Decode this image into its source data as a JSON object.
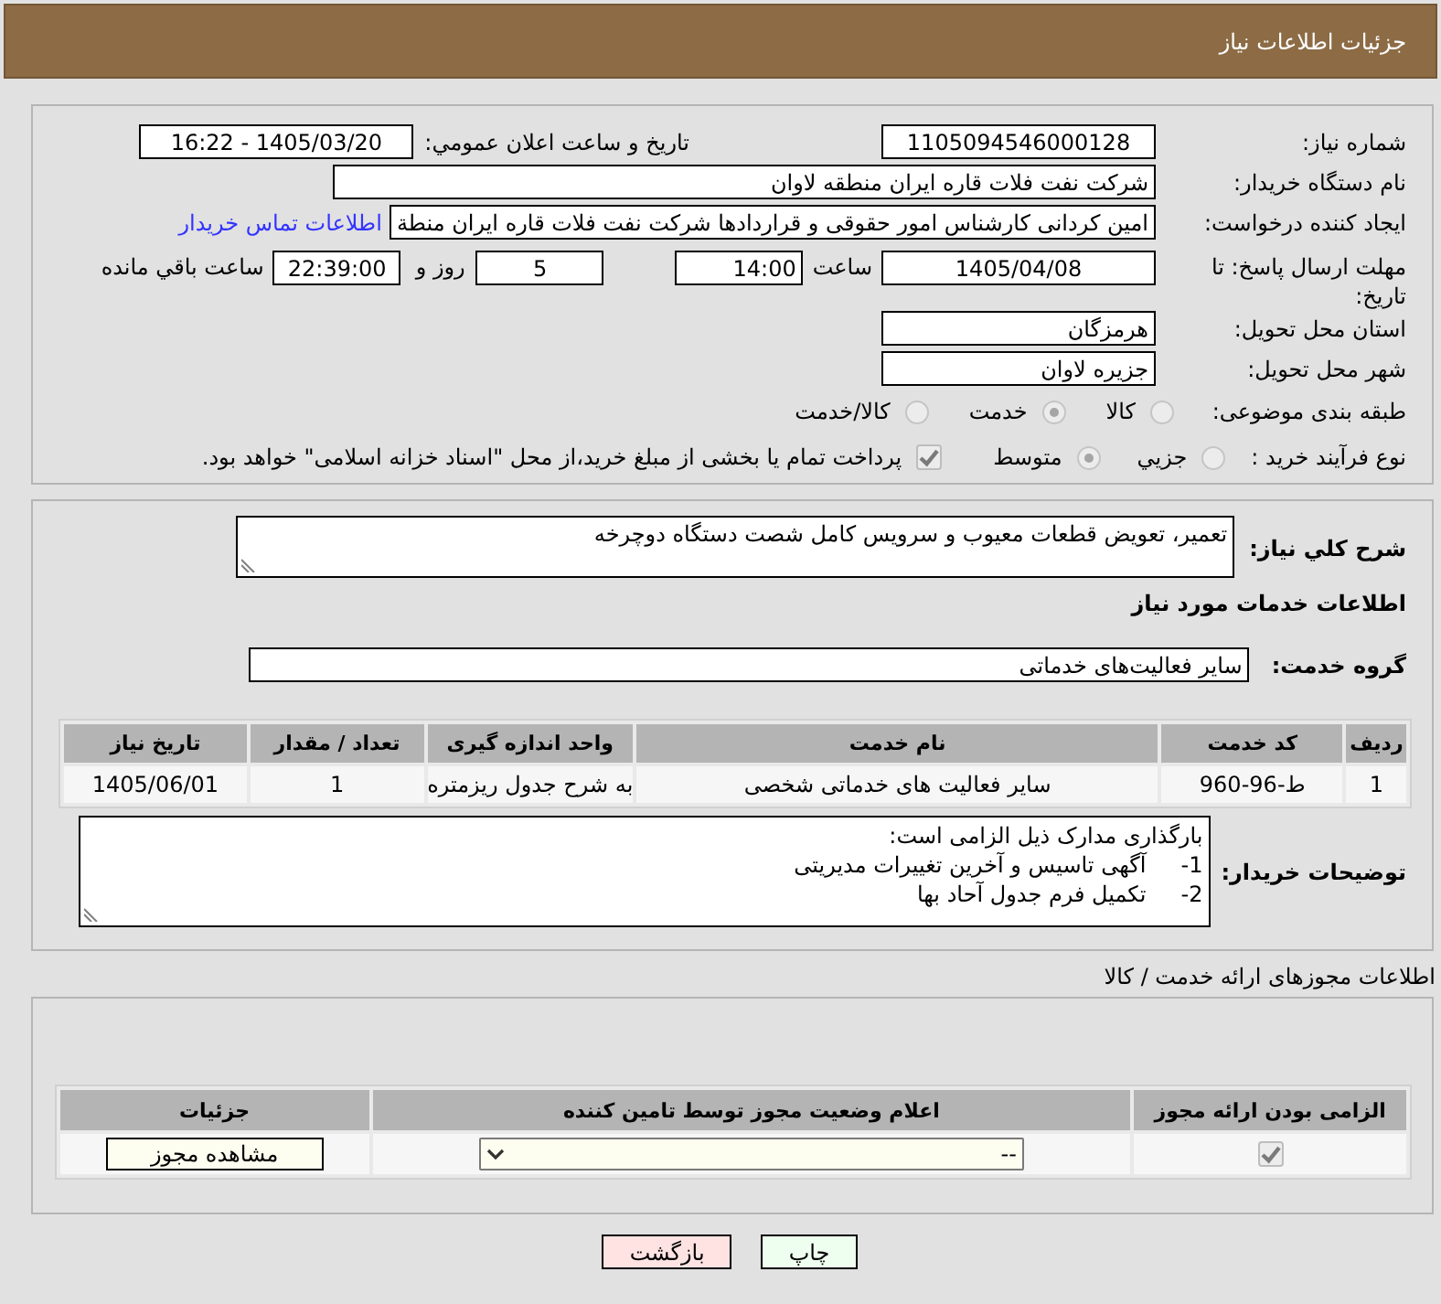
{
  "window": {
    "title": "جزئیات اطلاعات نیاز"
  },
  "need_form": {
    "need_number": {
      "label": "شماره نیاز:",
      "value": "1105094546000128"
    },
    "announce_datetime": {
      "label": "تاریخ و ساعت اعلان عمومي:",
      "value": "1405/03/20 - 16:22"
    },
    "buyer_org": {
      "label": "نام دستگاه خریدار:",
      "value": "شرکت نفت فلات قاره ایران منطقه لاوان"
    },
    "requester": {
      "label": "ایجاد کننده درخواست:",
      "value": "امین کردانی کارشناس امور حقوقی و قراردادها شرکت نفت فلات قاره ایران منطة",
      "contact_link": "اطلاعات تماس خریدار"
    },
    "deadline": {
      "label": "مهلت ارسال پاسخ: تا تاریخ:",
      "date": "1405/04/08",
      "time_label": "ساعت",
      "time": "14:00",
      "days": "5",
      "days_label": "روز و",
      "remaining_time": "22:39:00",
      "remaining_label": "ساعت باقي مانده"
    },
    "delivery_province": {
      "label": "استان محل تحویل:",
      "value": "هرمزگان"
    },
    "delivery_city": {
      "label": "شهر محل تحویل:",
      "value": "جزیره لاوان"
    },
    "category": {
      "label": "طبقه بندی موضوعی:",
      "options": [
        {
          "label": "کالا",
          "selected": false
        },
        {
          "label": "خدمت",
          "selected": true
        },
        {
          "label": "کالا/خدمت",
          "selected": false
        }
      ]
    },
    "purchase_process": {
      "label": "نوع فرآیند خرید :",
      "options": [
        {
          "label": "جزيي",
          "selected": false
        },
        {
          "label": "متوسط",
          "selected": true
        }
      ],
      "treasury_payment": {
        "label": "پرداخت تمام یا بخشی از مبلغ خرید،از محل \"اسناد خزانه اسلامی\" خواهد بود.",
        "checked": true
      }
    }
  },
  "need_details": {
    "description": {
      "label": "شرح کلي نياز:",
      "value": "تعمیر، تعویض قطعات معیوب و سرویس کامل شصت دستگاه دوچرخه"
    },
    "services_heading": "اطلاعات خدمات مورد نیاز",
    "service_group": {
      "label": "گروه خدمت:",
      "value": "سایر فعالیت‌های خدماتی"
    },
    "services_table": {
      "columns": [
        "ردیف",
        "کد خدمت",
        "نام خدمت",
        "واحد اندازه گیری",
        "تعداد / مقدار",
        "تاریخ نیاز"
      ],
      "rows": [
        [
          "1",
          "ط-96-960",
          "سایر فعالیت های خدماتی شخصی",
          "به شرح جدول ریزمتره",
          "1",
          "1405/06/01"
        ]
      ]
    },
    "buyer_notes": {
      "label": "توضیحات خریدار:",
      "lines": [
        "بارگذاری مدارک ذیل الزامی است:",
        "1-     آگهی تاسیس و آخرین تغییرات مدیریتی",
        "2-     تکمیل فرم جدول آحاد بها"
      ]
    }
  },
  "licenses": {
    "heading": "اطلاعات مجوزهای ارائه خدمت / کالا",
    "table": {
      "columns": [
        "الزامی بودن ارائه مجوز",
        "اعلام وضعیت مجوز توسط تامین کننده",
        "جزئیات"
      ],
      "rows": [
        {
          "required": true,
          "status": "--",
          "details_button": "مشاهده مجوز"
        }
      ]
    }
  },
  "buttons": [
    {
      "label": "چاپ",
      "kind": "print"
    },
    {
      "label": "بازگشت",
      "kind": "back"
    }
  ]
}
